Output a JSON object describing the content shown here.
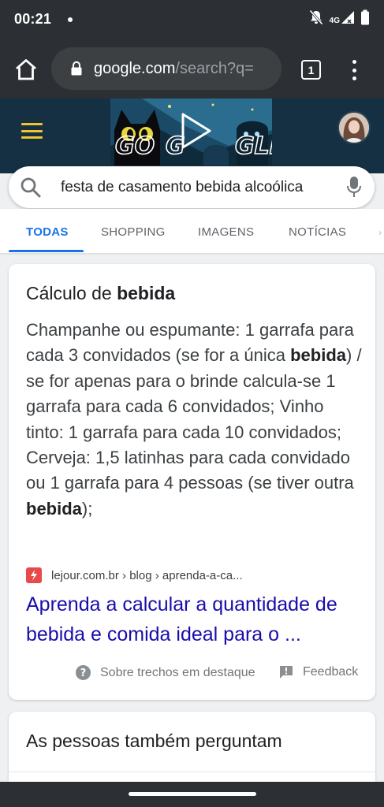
{
  "status_bar": {
    "time": "00:21",
    "network_label": "4G",
    "icons": [
      "notifications-off-icon",
      "signal-icon",
      "battery-icon"
    ]
  },
  "browser": {
    "url_host": "google.com",
    "url_path": "/search?q=",
    "tab_count": "1",
    "icons": [
      "home-icon",
      "lock-icon",
      "more-vert-icon"
    ]
  },
  "search": {
    "query": "festa de casamento bebida alcoólica"
  },
  "tabs": [
    {
      "label": "TODAS",
      "active": true
    },
    {
      "label": "SHOPPING",
      "active": false
    },
    {
      "label": "IMAGENS",
      "active": false
    },
    {
      "label": "NOTÍCIAS",
      "active": false
    }
  ],
  "featured_snippet": {
    "title_normal": "Cálculo de ",
    "title_bold": "bebida",
    "snippet_parts": [
      {
        "text": "Champanhe ou espumante: 1 garrafa para cada 3 convidados (se for a única ",
        "bold": false
      },
      {
        "text": "bebida",
        "bold": true
      },
      {
        "text": ") / se for apenas para o brinde calcula-se 1 garrafa para cada 6 convidados; Vinho tinto: 1 garrafa para cada 10 convidados; Cerveja: 1,5 latinhas para cada convidado ou 1 garrafa para 4 pessoas (se tiver outra ",
        "bold": false
      },
      {
        "text": "bebida",
        "bold": true
      },
      {
        "text": ");",
        "bold": false
      }
    ],
    "source_breadcrumb": "lejour.com.br › blog › aprenda-a-ca...",
    "link_title": "Aprenda a calcular a quantidade de bebida e comida ideal para o ...",
    "about_label": "Sobre trechos em destaque",
    "feedback_label": "Feedback"
  },
  "people_also_ask": {
    "title": "As pessoas também perguntam"
  },
  "colors": {
    "chrome_dark": "#2c2f33",
    "doodle_bg": "#153043",
    "accent_blue": "#1a73e8",
    "link_color": "#1a0dab",
    "hamburger_yellow": "#f1c232"
  }
}
